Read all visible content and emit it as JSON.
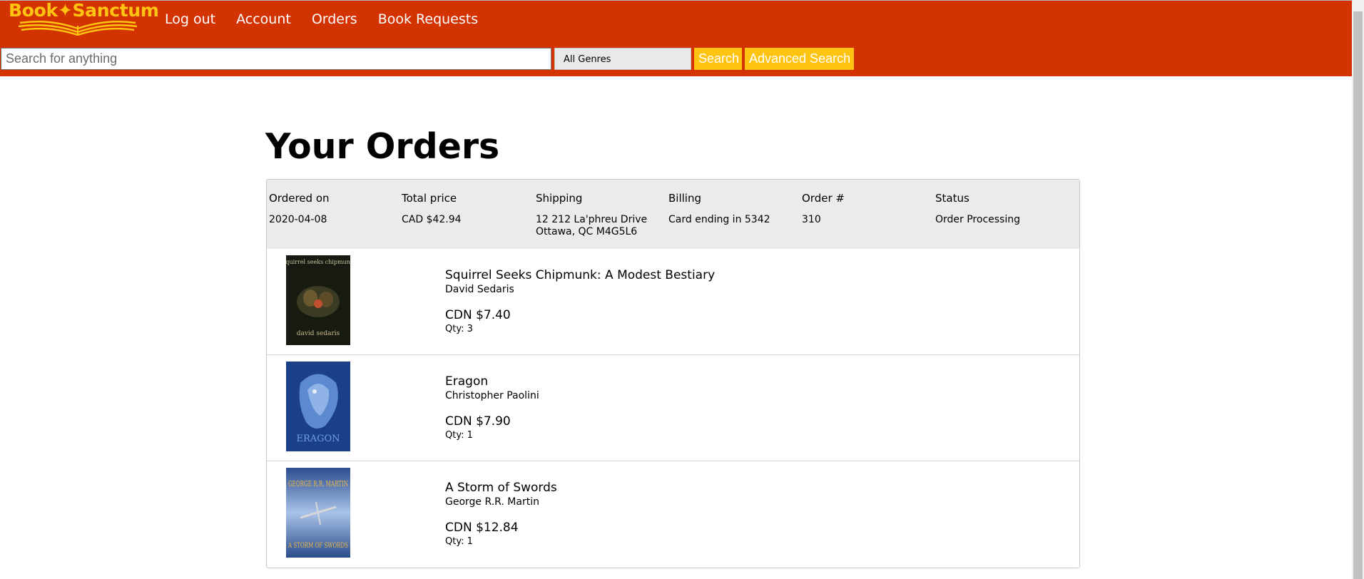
{
  "brand": {
    "name": "Book✦Sanctum",
    "logo_icon": "open-book-icon"
  },
  "nav": {
    "items": [
      {
        "label": "Log out"
      },
      {
        "label": "Account"
      },
      {
        "label": "Orders"
      },
      {
        "label": "Book Requests"
      }
    ]
  },
  "search": {
    "placeholder": "Search for anything",
    "value": "",
    "genre_selected": "All Genres",
    "search_label": "Search",
    "advanced_label": "Advanced Search"
  },
  "colors": {
    "header": "#d23300",
    "accent": "#ffc312",
    "summary_bg": "#ebebeb"
  },
  "page": {
    "title": "Your Orders"
  },
  "order": {
    "labels": {
      "ordered_on": "Ordered on",
      "total_price": "Total price",
      "shipping": "Shipping",
      "billing": "Billing",
      "order_number": "Order #",
      "status": "Status"
    },
    "ordered_on": "2020-04-08",
    "total_price": "CAD $42.94",
    "shipping_line1": "12 212 La'phreu Drive",
    "shipping_line2": "Ottawa, QC M4G5L6",
    "billing": "Card ending in 5342",
    "order_number": "310",
    "status": "Order Processing",
    "items": [
      {
        "title": "Squirrel Seeks Chipmunk: A Modest Bestiary",
        "author": "David Sedaris",
        "price": "CDN $7.40",
        "qty": "Qty: 3",
        "cover_text_top": "squirrel seeks chipmunk",
        "cover_text_bottom": "david sedaris"
      },
      {
        "title": "Eragon",
        "author": "Christopher Paolini",
        "price": "CDN $7.90",
        "qty": "Qty: 1",
        "cover_text_top": "",
        "cover_text_bottom": "ERAGON"
      },
      {
        "title": "A Storm of Swords",
        "author": "George R.R. Martin",
        "price": "CDN $12.84",
        "qty": "Qty: 1",
        "cover_text_top": "GEORGE R.R. MARTIN",
        "cover_text_bottom": "A STORM OF SWORDS"
      }
    ]
  }
}
